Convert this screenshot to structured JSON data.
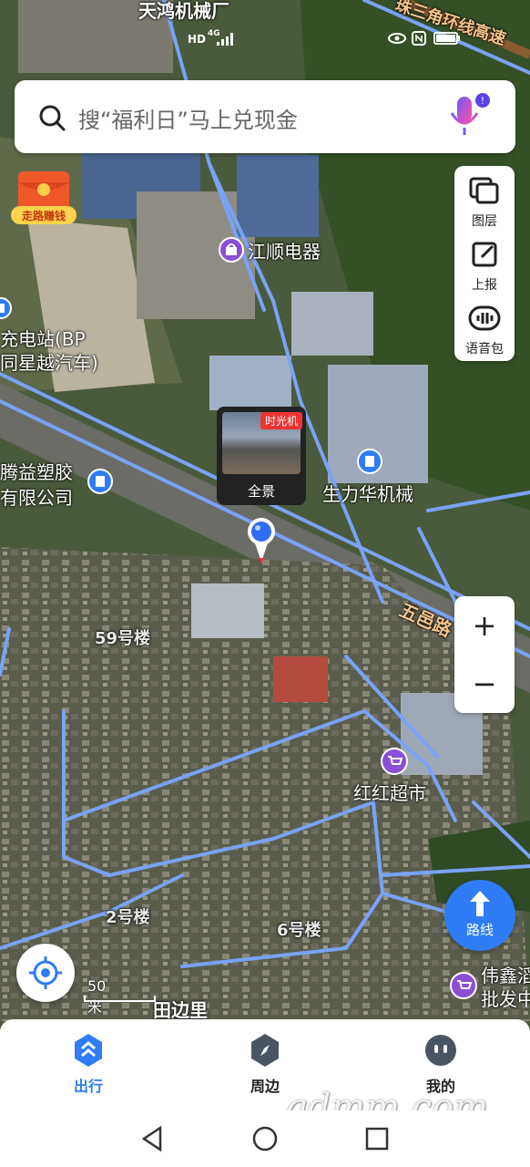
{
  "status_bar": {
    "hd": "HD",
    "signal": "4G"
  },
  "search": {
    "placeholder": "搜“福利日”马上兑现金"
  },
  "promo": {
    "label": "走路赚钱"
  },
  "tools": [
    {
      "label": "图层",
      "icon": "layers-icon"
    },
    {
      "label": "上报",
      "icon": "report-edit-icon"
    },
    {
      "label": "语音包",
      "icon": "voice-pack-icon"
    }
  ],
  "map_labels": {
    "top_factory": "天鸿机械厂",
    "highway_top": "珠三角环线高速",
    "store_jiangshun": "江顺电器",
    "gas_station_line1": "充电站(BP",
    "gas_station_line2": "同星越汽车)",
    "tengyi_line1": "腾益塑胶",
    "tengyi_line2": "有限公司",
    "shenglihua": "生力华机械",
    "wuyi_road": "五邑路",
    "bldg_59": "59号楼",
    "honghong": "红红超市",
    "bldg_2": "2号楼",
    "bldg_6": "6号楼",
    "weixin_line1": "伟鑫滔",
    "weixin_line2": "批发中",
    "tianbianli": "田边里"
  },
  "panorama": {
    "tag": "时光机",
    "caption": "全景"
  },
  "zoom": {
    "in": "+",
    "out": "−"
  },
  "scale": {
    "label": "50米"
  },
  "route_button": {
    "label": "路线"
  },
  "tabs": [
    {
      "label": "出行",
      "active": true
    },
    {
      "label": "周边",
      "active": false
    },
    {
      "label": "我的",
      "active": false
    }
  ],
  "watermark": "gdmm.com",
  "colors": {
    "accent": "#2f7cf6",
    "road": "#7aa2f7",
    "promo": "#f0582a"
  }
}
